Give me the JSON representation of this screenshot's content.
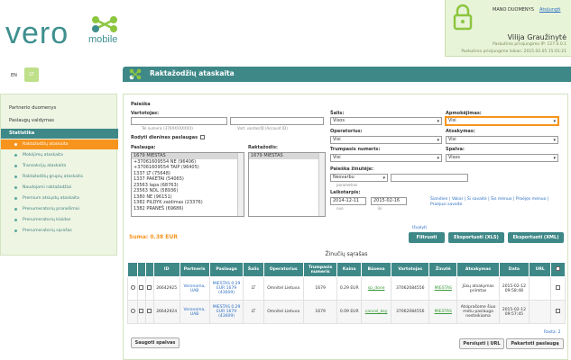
{
  "brand": {
    "word": "vero",
    "sub": "mobile"
  },
  "user": {
    "label": "MANO DUOMENYS",
    "logout": "Atsijungti",
    "name": "Vilija Graužinytė",
    "ip": "Paskutinio prisijungimo IP: 127.0.0.1",
    "time": "Paskutinio prisijungimo laikas: 2015.02.05 15:01:21"
  },
  "lang": {
    "en": "EN",
    "lt": "LT"
  },
  "sidebar": {
    "items": [
      "Partnerio duomenys",
      "Paslaugų valdymas",
      "Statistika"
    ],
    "sub": [
      "Raktažodžių ataskaita",
      "Mokėjimų ataskaita",
      "Transakcijų ataskaita",
      "Raktažodžių grupių ataskaita",
      "Naudojami raktažodžiai",
      "Premium atsiųstų ataskaita",
      "Prenumeratorių pranešimai",
      "Prenumeratorių klaidos",
      "Prenumeratorių sąrašas"
    ]
  },
  "page": {
    "title": "Raktažodžių ataskaita"
  },
  "filters": {
    "section": "Paieška",
    "phone_label": "Vartotojas:",
    "phone_value": "",
    "phone_hint": "Tel.numeris (370XXXXXXXX)",
    "user_id_hint": "Vart. vardas/ID (Account ID)",
    "show_hidden": "Rodyti dienines paslaugas",
    "country_label": "Šalis:",
    "country_value": "Visos",
    "payment_label": "Apmokėjimas:",
    "payment_value": "Visi",
    "operator_label": "Operatorius:",
    "operator_value": "Visi",
    "response_label": "Atsakymas:",
    "response_value": "Visi",
    "short_label": "Trumpasis numeris:",
    "short_value": "Visi",
    "color_label": "Spalva:",
    "color_value": "Visos",
    "msg_search_label": "Paieška žinutėje:",
    "msg_search_value": "Nesvarbu",
    "msg_search_hint": "parametras",
    "service_label": "Paslauga:",
    "service_options": [
      "1679 MIESTAS",
      "+37061609554 NE (96406)",
      "+37061609554 TAIP (96405)",
      "1337 LT (75648)",
      "1337 PAKETAI (54065)",
      "23563 lapa (68763)",
      "23563 NDL (58936)",
      "1380 NE (96151)",
      "1382 PILDYK zaidimas (23376)",
      "1382 PRANEŠ (69686)"
    ],
    "keyword_label": "Raktažodis:",
    "keyword_options": [
      "1679 MIESTAS"
    ],
    "period_label": "Laikotarpis:",
    "date_from": "2014-12-11",
    "date_to": "2015-02-16",
    "date_from_hint": "nuo",
    "date_to_hint": "iki",
    "quick_links": "Šiandien | Vakar | Ši savaitė | Šis mėnuo | Praėjęs mėnuo | Praėjusi savaitė",
    "clear_link": "Išvalyti"
  },
  "buttons": {
    "filter": "Filtruoti",
    "export_xls": "Eksportuoti (XLS)",
    "export_xml": "Eksportuoti (XML)",
    "save_colors": "Saugoti spalvas",
    "resend": "Persiųsti į URL",
    "repeat": "Pakartoti paslaugą"
  },
  "summary": {
    "sum": "Suma: 0.38 EUR"
  },
  "table": {
    "title": "Žinučių sąrašas",
    "headers": [
      "",
      "",
      "",
      "ID",
      "Partneris",
      "Paslauga",
      "Šalis",
      "Operatorius",
      "Trumpasis numeris",
      "Kaina",
      "Būsena",
      "Vartotojas",
      "Žinutė",
      "Atsakymas",
      "Data",
      "URL",
      ""
    ],
    "rows": [
      {
        "id": "26642925",
        "partner": "Veronoma, UAB",
        "service": "MIESTAS 0.29 EUR 1679 (43609)",
        "country": "LT",
        "operator": "Omnitel Lietuva",
        "short": "1679",
        "price": "0.29 EUR",
        "status": "sp_done",
        "user": "37062084556",
        "message": "MIESTAS",
        "response": "Jūsų atsakymas priimtas",
        "date": "2015-02-12 09:58:48"
      },
      {
        "id": "26642924",
        "partner": "Veronoma, UAB",
        "service": "MIESTAS 0.29 EUR 1679 (43609)",
        "country": "LT",
        "operator": "Omnitel Lietuva",
        "short": "1679",
        "price": "0.09 EUR",
        "status": "cancel_key",
        "user": "37062084556",
        "message": "MIESTAS",
        "response": "Atsiprašome šiuo metu paslauga nesteikiama",
        "date": "2015-02-12 09:57:45"
      }
    ],
    "pager": "Rasta: 2"
  },
  "colors": {
    "accent": "#3f8888",
    "orange": "#f7941d",
    "panel": "#e8f4d8"
  }
}
